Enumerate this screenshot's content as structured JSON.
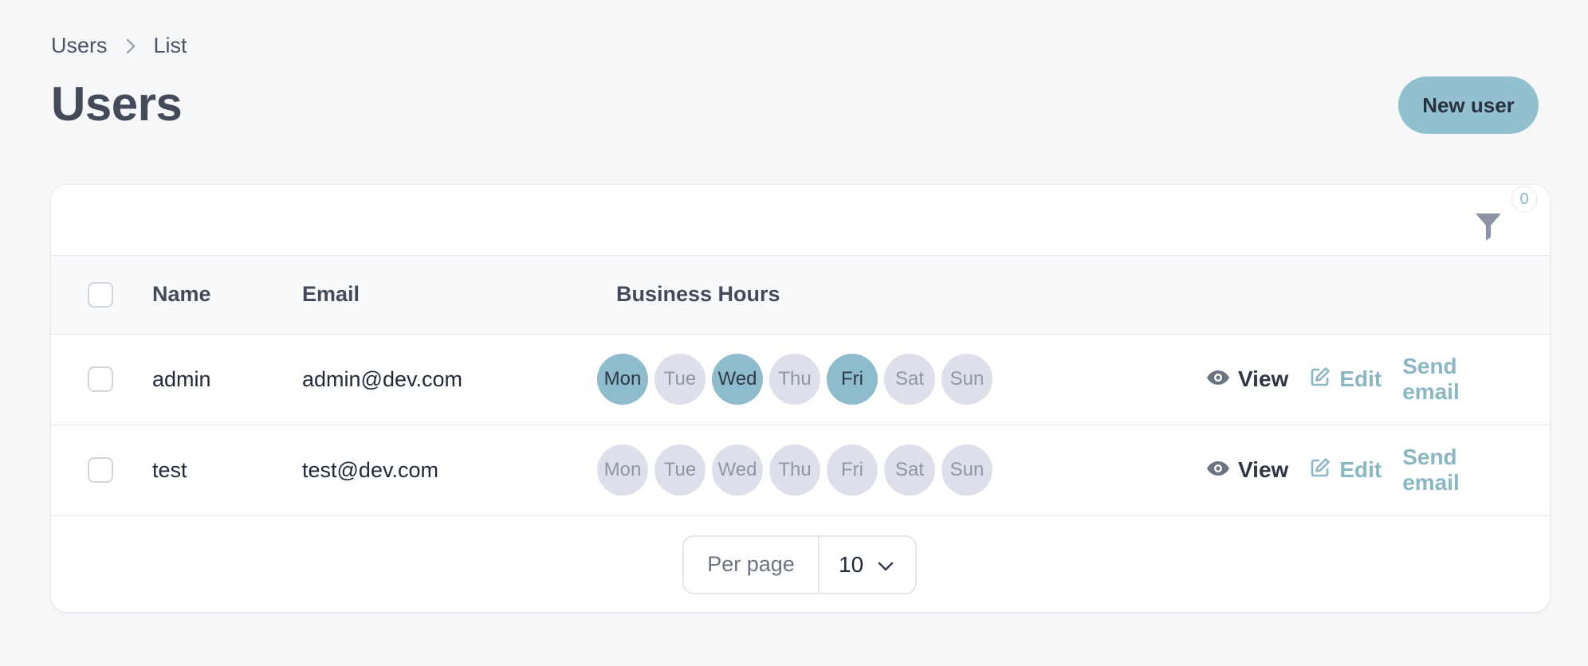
{
  "breadcrumb": {
    "items": [
      "Users",
      "List"
    ]
  },
  "page": {
    "title": "Users"
  },
  "header": {
    "new_user_label": "New user"
  },
  "toolbar": {
    "filter_count": "0"
  },
  "table": {
    "columns": {
      "name": "Name",
      "email": "Email",
      "hours": "Business Hours"
    },
    "rows": [
      {
        "name": "admin",
        "email": "admin@dev.com",
        "days": [
          {
            "label": "Mon",
            "active": true
          },
          {
            "label": "Tue",
            "active": false
          },
          {
            "label": "Wed",
            "active": true
          },
          {
            "label": "Thu",
            "active": false
          },
          {
            "label": "Fri",
            "active": true
          },
          {
            "label": "Sat",
            "active": false
          },
          {
            "label": "Sun",
            "active": false
          }
        ]
      },
      {
        "name": "test",
        "email": "test@dev.com",
        "days": [
          {
            "label": "Mon",
            "active": false
          },
          {
            "label": "Tue",
            "active": false
          },
          {
            "label": "Wed",
            "active": false
          },
          {
            "label": "Thu",
            "active": false
          },
          {
            "label": "Fri",
            "active": false
          },
          {
            "label": "Sat",
            "active": false
          },
          {
            "label": "Sun",
            "active": false
          }
        ]
      }
    ],
    "actions": {
      "view": "View",
      "edit": "Edit",
      "send_email": "Send email"
    }
  },
  "pagination": {
    "per_page_label": "Per page",
    "per_page_value": "10"
  },
  "colors": {
    "accent": "#93c0cf",
    "day_active": "#8fbccc",
    "day_inactive": "#dde0ea",
    "link": "#8bb6c4"
  },
  "icons": {
    "filter": "filter-icon",
    "view": "eye-icon",
    "edit": "pencil-square-icon",
    "breadcrumb_separator": "chevron-right-icon",
    "select": "chevron-down-icon"
  }
}
